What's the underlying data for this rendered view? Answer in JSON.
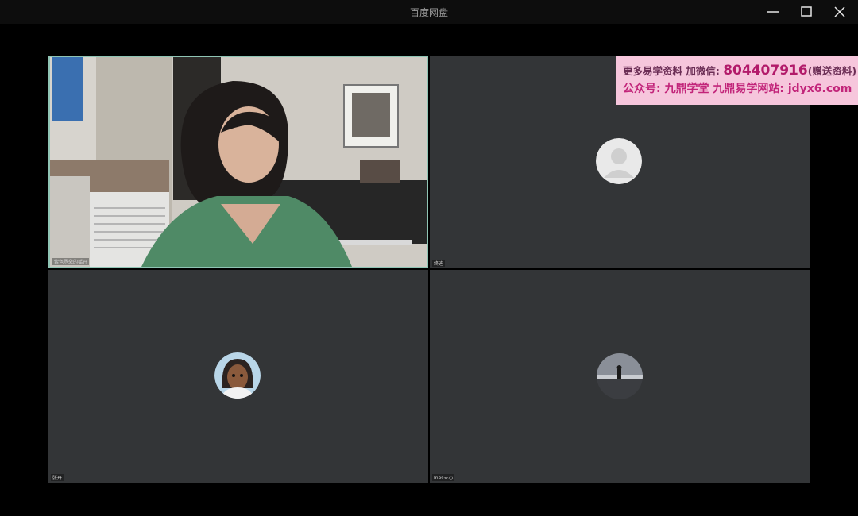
{
  "window": {
    "title": "百度网盘",
    "controls": {
      "minimize_icon": "minimize-icon",
      "maximize_icon": "maximize-icon",
      "close_icon": "close-icon"
    }
  },
  "participants": [
    {
      "name": "紫色丞朵的摇开",
      "video": "camera-on"
    },
    {
      "name": "终迪",
      "video": "avatar"
    },
    {
      "name": "张丹",
      "video": "avatar"
    },
    {
      "name": "Ines未心",
      "video": "avatar"
    }
  ],
  "watermark": {
    "line1_prefix": "更多易学资料 加微信:",
    "line1_number": "804407916",
    "line1_suffix": "(赠送资料)",
    "line2": "公众号: 九鼎学堂 九鼎易学网站: jdyx6.com"
  },
  "colors": {
    "active_speaker_border": "#8fc4b4",
    "tile_bg": "#333537"
  }
}
